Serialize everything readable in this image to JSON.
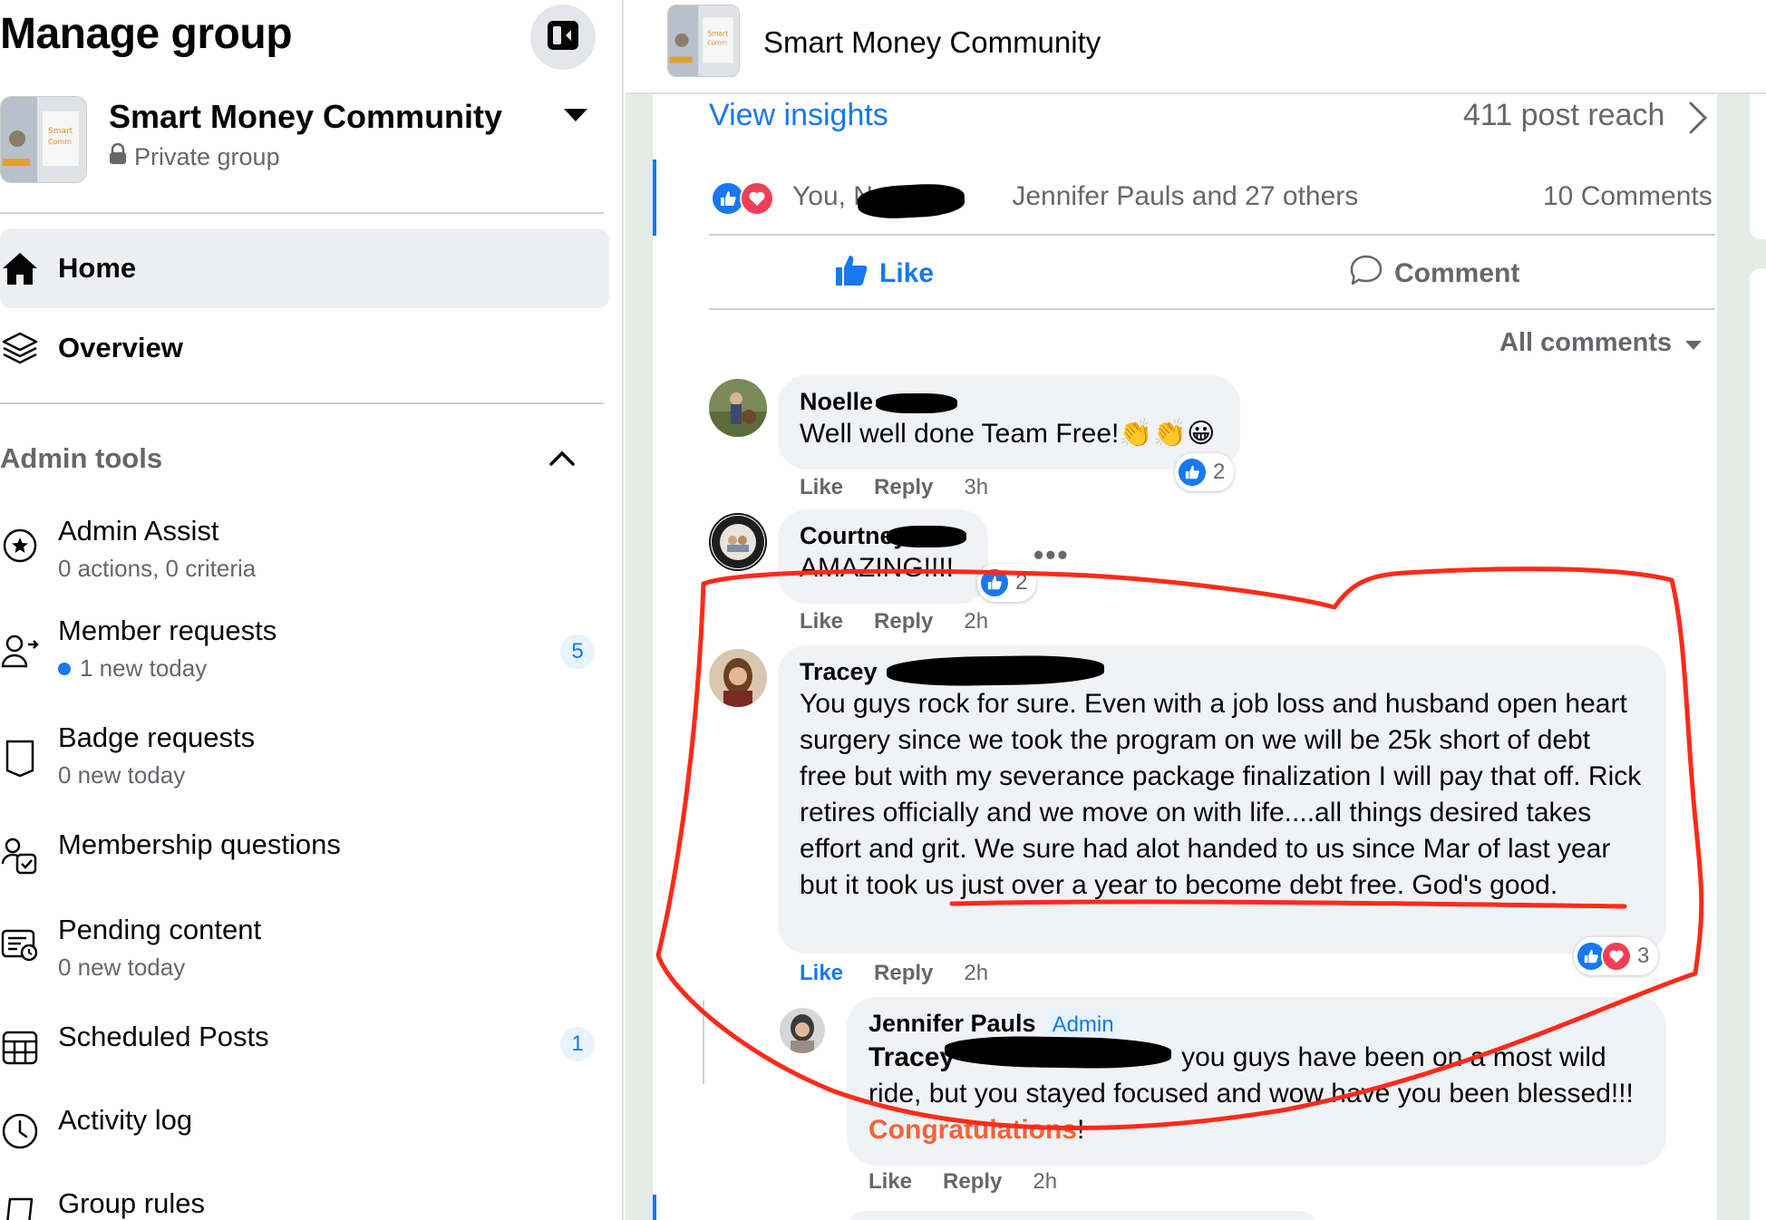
{
  "sidebar": {
    "title": "Manage group",
    "group_name": "Smart Money Community",
    "privacy": "Private group",
    "nav": [
      {
        "label": "Home",
        "active": true
      },
      {
        "label": "Overview",
        "active": false
      }
    ],
    "admin_tools_label": "Admin tools",
    "tools": [
      {
        "label": "Admin Assist",
        "sub": "0 actions, 0 criteria",
        "icon": "admin-assist-icon"
      },
      {
        "label": "Member requests",
        "sub": "1 new today",
        "icon": "member-requests-icon",
        "badge": "5"
      },
      {
        "label": "Badge requests",
        "sub": "0 new today",
        "icon": "badge-icon"
      },
      {
        "label": "Membership questions",
        "sub": "",
        "icon": "questions-icon"
      },
      {
        "label": "Pending content",
        "sub": "0 new today",
        "icon": "pending-content-icon"
      },
      {
        "label": "Scheduled Posts",
        "sub": "",
        "icon": "calendar-icon",
        "badge": "1"
      },
      {
        "label": "Activity log",
        "sub": "",
        "icon": "clock-icon"
      },
      {
        "label": "Group rules",
        "sub": "",
        "icon": "rules-icon"
      }
    ]
  },
  "header": {
    "group_name": "Smart Money Community"
  },
  "post": {
    "view_insights": "View insights",
    "post_reach": "411 post reach",
    "reactions_names_a": "You, Noelle",
    "reactions_names_b": "Jennifer Pauls and 27 others",
    "comments_count": "10 Comments",
    "like_label": "Like",
    "comment_label": "Comment",
    "all_comments": "All comments"
  },
  "comments": [
    {
      "name": "Noelle",
      "text": "Well well done Team Free!",
      "emoji": "👏👏😀",
      "like": "Like",
      "reply": "Reply",
      "time": "3h",
      "reaction_count": "2"
    },
    {
      "name": "Courtney",
      "text": "AMAZING!!!!",
      "like": "Like",
      "reply": "Reply",
      "time": "2h",
      "reaction_count": "2"
    },
    {
      "name": "Tracey",
      "text": "You guys rock for sure. Even with a job loss and husband open heart surgery since we took the program on we will be 25k short of debt free but with my severance package finalization I will pay that off. Rick retires officially and we move on with life....all things desired takes effort and grit. We sure had alot handed to us since Mar of last year but it took us just over a year to become debt free. God's good.",
      "like": "Like",
      "reply": "Reply",
      "time": "2h",
      "reaction_count": "3"
    },
    {
      "name": "Jennifer Pauls",
      "admin_tag": "Admin",
      "mention": "Tracey",
      "text_a": "you guys have been on a most wild ride, but you stayed focused and wow have you been blessed!!! ",
      "congrats": "Congratulations",
      "text_b": "!",
      "like": "Like",
      "reply": "Reply",
      "time": "2h"
    }
  ],
  "colors": {
    "accent": "#1877f2",
    "love": "#f33e58",
    "annotation": "#ff2a1a",
    "congrats": "#f0643a"
  }
}
